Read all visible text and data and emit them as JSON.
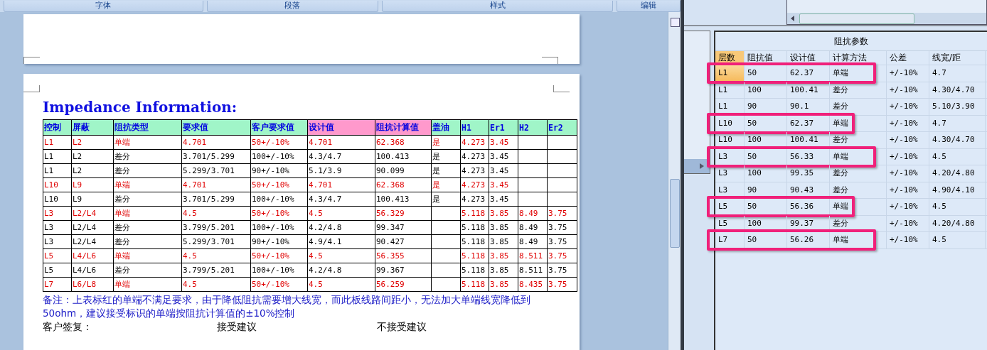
{
  "ribbon_groups": [
    "字体",
    "段落",
    "样式",
    "编辑"
  ],
  "document": {
    "heading": "Impedance Information:",
    "columns": [
      {
        "label": "控制",
        "color": "#a0f5c8"
      },
      {
        "label": "屏蔽",
        "color": "#a0f5c8"
      },
      {
        "label": "阻抗类型",
        "color": "#a0f5c8"
      },
      {
        "label": "要求值",
        "color": "#a0f5c8"
      },
      {
        "label": "客户要求值",
        "color": "#a0f5c8"
      },
      {
        "label": "设计值",
        "color": "#ff99cc"
      },
      {
        "label": "阻抗计算值",
        "color": "#ff99cc"
      },
      {
        "label": "盖油",
        "color": "#a0f5c8"
      },
      {
        "label": "H1",
        "color": "#a0f5c8"
      },
      {
        "label": "Er1",
        "color": "#a0f5c8"
      },
      {
        "label": "H2",
        "color": "#a0f5c8"
      },
      {
        "label": "Er2",
        "color": "#a0f5c8"
      }
    ],
    "rows": [
      {
        "flagged": true,
        "cells": [
          "L1",
          "L2",
          "单端",
          "4.701",
          "50+/-10%",
          "4.701",
          "62.368",
          "是",
          "4.273",
          "3.45",
          "",
          ""
        ]
      },
      {
        "flagged": false,
        "cells": [
          "L1",
          "L2",
          "差分",
          "3.701/5.299",
          "100+/-10%",
          "4.3/4.7",
          "100.413",
          "是",
          "4.273",
          "3.45",
          "",
          ""
        ]
      },
      {
        "flagged": false,
        "cells": [
          "L1",
          "L2",
          "差分",
          "5.299/3.701",
          "90+/-10%",
          "5.1/3.9",
          "90.099",
          "是",
          "4.273",
          "3.45",
          "",
          ""
        ]
      },
      {
        "flagged": true,
        "cells": [
          "L10",
          "L9",
          "单端",
          "4.701",
          "50+/-10%",
          "4.701",
          "62.368",
          "是",
          "4.273",
          "3.45",
          "",
          ""
        ]
      },
      {
        "flagged": false,
        "cells": [
          "L10",
          "L9",
          "差分",
          "3.701/5.299",
          "100+/-10%",
          "4.3/4.7",
          "100.413",
          "是",
          "4.273",
          "3.45",
          "",
          ""
        ]
      },
      {
        "flagged": true,
        "cells": [
          "L3",
          "L2/L4",
          "单端",
          "4.5",
          "50+/-10%",
          "4.5",
          "56.329",
          "",
          "5.118",
          "3.85",
          "8.49",
          "3.75"
        ]
      },
      {
        "flagged": false,
        "cells": [
          "L3",
          "L2/L4",
          "差分",
          "3.799/5.201",
          "100+/-10%",
          "4.2/4.8",
          "99.347",
          "",
          "5.118",
          "3.85",
          "8.49",
          "3.75"
        ]
      },
      {
        "flagged": false,
        "cells": [
          "L3",
          "L2/L4",
          "差分",
          "5.299/3.701",
          "90+/-10%",
          "4.9/4.1",
          "90.427",
          "",
          "5.118",
          "3.85",
          "8.49",
          "3.75"
        ]
      },
      {
        "flagged": true,
        "cells": [
          "L5",
          "L4/L6",
          "单端",
          "4.5",
          "50+/-10%",
          "4.5",
          "56.355",
          "",
          "5.118",
          "3.85",
          "8.511",
          "3.75"
        ]
      },
      {
        "flagged": false,
        "cells": [
          "L5",
          "L4/L6",
          "差分",
          "3.799/5.201",
          "100+/-10%",
          "4.2/4.8",
          "99.367",
          "",
          "5.118",
          "3.85",
          "8.511",
          "3.75"
        ]
      },
      {
        "flagged": true,
        "cells": [
          "L7",
          "L6/L8",
          "单端",
          "4.5",
          "50+/-10%",
          "4.5",
          "56.259",
          "",
          "5.118",
          "3.85",
          "8.435",
          "3.75"
        ]
      }
    ],
    "note": "备注：上表标红的单端不满足要求，由于降低阻抗需要增大线宽，而此板线路间距小，无法加大单端线宽降低到50ohm，建议接受标识的单端按阻抗计算值的±10%控制",
    "reply": [
      "客户签复：",
      "接受建议",
      "不接受建议"
    ]
  },
  "grid": {
    "title": "阻抗参数",
    "columns": [
      "层数",
      "阻抗值",
      "设计值",
      "计算方法",
      "公差",
      "线宽/距"
    ],
    "rows": [
      {
        "current": true,
        "marked": true,
        "cells": [
          "L1",
          "50",
          "62.37",
          "单端",
          "+/-10%",
          "4.7"
        ]
      },
      {
        "current": false,
        "marked": false,
        "cells": [
          "L1",
          "100",
          "100.41",
          "差分",
          "+/-10%",
          "4.30/4.70"
        ]
      },
      {
        "current": false,
        "marked": false,
        "cells": [
          "L1",
          "90",
          "90.1",
          "差分",
          "+/-10%",
          "5.10/3.90"
        ]
      },
      {
        "current": false,
        "marked": true,
        "cells": [
          "L10",
          "50",
          "62.37",
          "单端",
          "+/-10%",
          "4.7"
        ]
      },
      {
        "current": false,
        "marked": false,
        "cells": [
          "L10",
          "100",
          "100.41",
          "差分",
          "+/-10%",
          "4.30/4.70"
        ]
      },
      {
        "current": false,
        "marked": true,
        "cells": [
          "L3",
          "50",
          "56.33",
          "单端",
          "+/-10%",
          "4.5"
        ]
      },
      {
        "current": false,
        "marked": false,
        "cells": [
          "L3",
          "100",
          "99.35",
          "差分",
          "+/-10%",
          "4.20/4.80"
        ]
      },
      {
        "current": false,
        "marked": false,
        "cells": [
          "L3",
          "90",
          "90.43",
          "差分",
          "+/-10%",
          "4.90/4.10"
        ]
      },
      {
        "current": false,
        "marked": true,
        "cells": [
          "L5",
          "50",
          "56.36",
          "单端",
          "+/-10%",
          "4.5"
        ]
      },
      {
        "current": false,
        "marked": false,
        "cells": [
          "L5",
          "100",
          "99.37",
          "差分",
          "+/-10%",
          "4.20/4.80"
        ]
      },
      {
        "current": false,
        "marked": true,
        "cells": [
          "L7",
          "50",
          "56.26",
          "单端",
          "+/-10%",
          "4.5"
        ]
      }
    ]
  }
}
